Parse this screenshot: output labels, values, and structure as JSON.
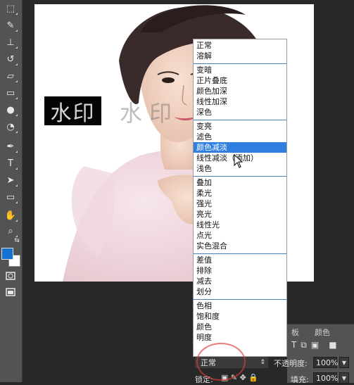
{
  "tools": [
    {
      "name": "marquee-tool",
      "glyph": "⬚"
    },
    {
      "name": "brush-tool",
      "glyph": "✎"
    },
    {
      "name": "stamp-tool",
      "glyph": "⊥"
    },
    {
      "name": "history-brush-tool",
      "glyph": "↺"
    },
    {
      "name": "eraser-tool",
      "glyph": "▱"
    },
    {
      "name": "gradient-tool",
      "glyph": "▭"
    },
    {
      "name": "blur-tool",
      "glyph": "●"
    },
    {
      "name": "dodge-tool",
      "glyph": "◔"
    },
    {
      "name": "pen-tool",
      "glyph": "✒"
    },
    {
      "name": "type-tool",
      "glyph": "T"
    },
    {
      "name": "path-select-tool",
      "glyph": "➤"
    },
    {
      "name": "shape-tool",
      "glyph": "▭"
    },
    {
      "name": "hand-tool",
      "glyph": "✋"
    },
    {
      "name": "zoom-tool",
      "glyph": "⌕"
    }
  ],
  "colors": {
    "foreground": "#1473d1",
    "background": "#ffffff",
    "accent_selected": "#2f7fe0"
  },
  "canvas": {
    "watermark_text": "水印",
    "watermark_ghost_text": "水印 水印"
  },
  "blend_menu": {
    "groups": [
      [
        "正常",
        "溶解"
      ],
      [
        "变暗",
        "正片叠底",
        "颜色加深",
        "线性加深",
        "深色"
      ],
      [
        "变亮",
        "滤色",
        "颜色减淡",
        "线性减淡（添加）",
        "浅色"
      ],
      [
        "叠加",
        "柔光",
        "强光",
        "亮光",
        "线性光",
        "点光",
        "实色混合"
      ],
      [
        "差值",
        "排除",
        "减去",
        "划分"
      ],
      [
        "色相",
        "饱和度",
        "颜色",
        "明度"
      ]
    ],
    "selected": "颜色减淡"
  },
  "layers_panel": {
    "tabs": [
      "板",
      "颜色"
    ],
    "blend_mode_value": "正常",
    "opacity_label": "不透明度:",
    "opacity_value": "100%",
    "lock_label": "锁定:",
    "fill_label": "填充:",
    "fill_value": "100%"
  }
}
